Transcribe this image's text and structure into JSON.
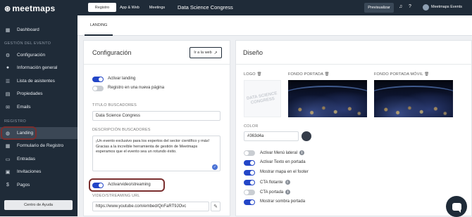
{
  "brand": {
    "logo_text": "meetmaps"
  },
  "sidebar": {
    "dashboard": "Dashboard",
    "section_gestion": "GESTIÓN DEL EVENTO",
    "configuracion": "Configuración",
    "informacion": "Información general",
    "asistentes": "Lista de asistentes",
    "propiedades": "Propiedades",
    "emails": "Emails",
    "section_registro": "REGISTRO",
    "landing": "Landing",
    "formulario": "Formulario de Registro",
    "entradas": "Entradas",
    "invitaciones": "Invitaciones",
    "pagos": "Pagos",
    "help": "Centro de Ayuda"
  },
  "topbar": {
    "tabs": [
      "Registro",
      "App & Web",
      "Meetings"
    ],
    "event_title": "Data Science Congress",
    "preview": "Previsualizar",
    "user": "Meetmaps Events"
  },
  "subtab": "LANDING",
  "config": {
    "title": "Configuración",
    "web_button": "Ir a la web",
    "toggle_landing": "Activar landing",
    "toggle_newpage": "Registro en una nueva página",
    "seo_title_label": "TITULO BUSCADORES",
    "seo_title_value": "Data Science Congress",
    "seo_desc_label": "DESCRIPCIÓN BUSCADORES",
    "seo_desc_value": "¡Un evento exclusivo para los expertos del sector científico y más! Gracias a la increíble herramienta de gestión de Meetmaps esperamos que el evento sea un rotundo éxito.",
    "toggle_video": "Activarvideo/streaming",
    "video_label": "VIDEO/STREAMING URL",
    "video_value": "https://www.youtube.com/embed/QnFaRT9JOvc"
  },
  "design": {
    "title": "Diseño",
    "logo_label": "LOGO",
    "logo_placeholder": "DATA SCIENCE CONGRESS",
    "cover_label": "FONDO PORTADA",
    "cover_mobile_label": "FONDO PORTADA MÓVIL",
    "color_label": "COLOR",
    "color_value": "#363d4a",
    "options": [
      {
        "label": "Activar Menú lateral",
        "on": false,
        "info": true
      },
      {
        "label": "Activar Texto en portada",
        "on": true,
        "info": false
      },
      {
        "label": "Mostrar mapa en el footer",
        "on": true,
        "info": false
      },
      {
        "label": "CTA flotante",
        "on": true,
        "info": true
      },
      {
        "label": "CTA portada",
        "on": false,
        "info": true
      },
      {
        "label": "Mostrar sombra portada",
        "on": true,
        "info": false
      }
    ]
  },
  "colors": {
    "accent": "#2346c7",
    "sidebar": "#1f2b38",
    "highlight": "#7a2e2e"
  }
}
